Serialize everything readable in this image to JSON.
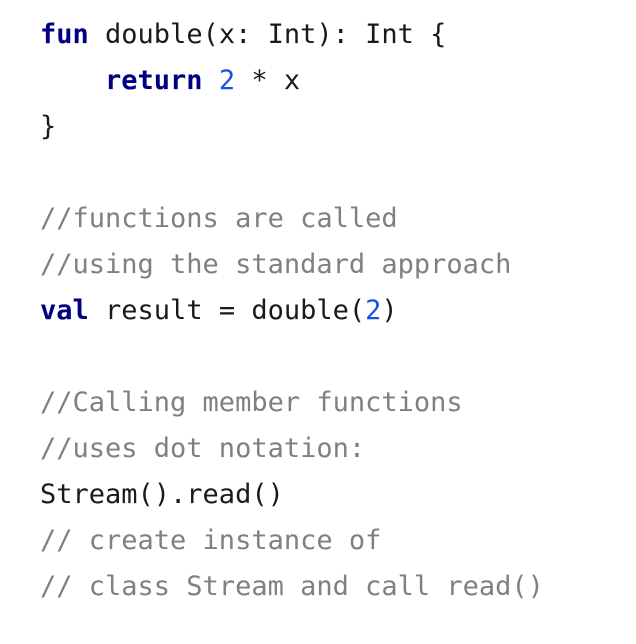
{
  "colors": {
    "background": "#ffffff",
    "text": "#1a1a1a",
    "keyword": "#000080",
    "number": "#1750eb",
    "comment": "#808080"
  },
  "code": {
    "l1": {
      "kw": "fun",
      "rest": " double(x: Int): Int {"
    },
    "l2": {
      "indent": "    ",
      "kw": "return",
      "pre": " ",
      "num": "2",
      "rest": " * x"
    },
    "l3": {
      "text": "}"
    },
    "l5": {
      "comment": "//functions are called"
    },
    "l6": {
      "comment": "//using the standard approach"
    },
    "l7": {
      "kw": "val",
      "pre": " result = double(",
      "num": "2",
      "post": ")"
    },
    "l9": {
      "comment": "//Calling member functions"
    },
    "l10": {
      "comment": "//uses dot notation:"
    },
    "l11": {
      "text": "Stream().read()"
    },
    "l12": {
      "comment": "// create instance of"
    },
    "l13": {
      "comment": "// class Stream and call read()"
    }
  }
}
